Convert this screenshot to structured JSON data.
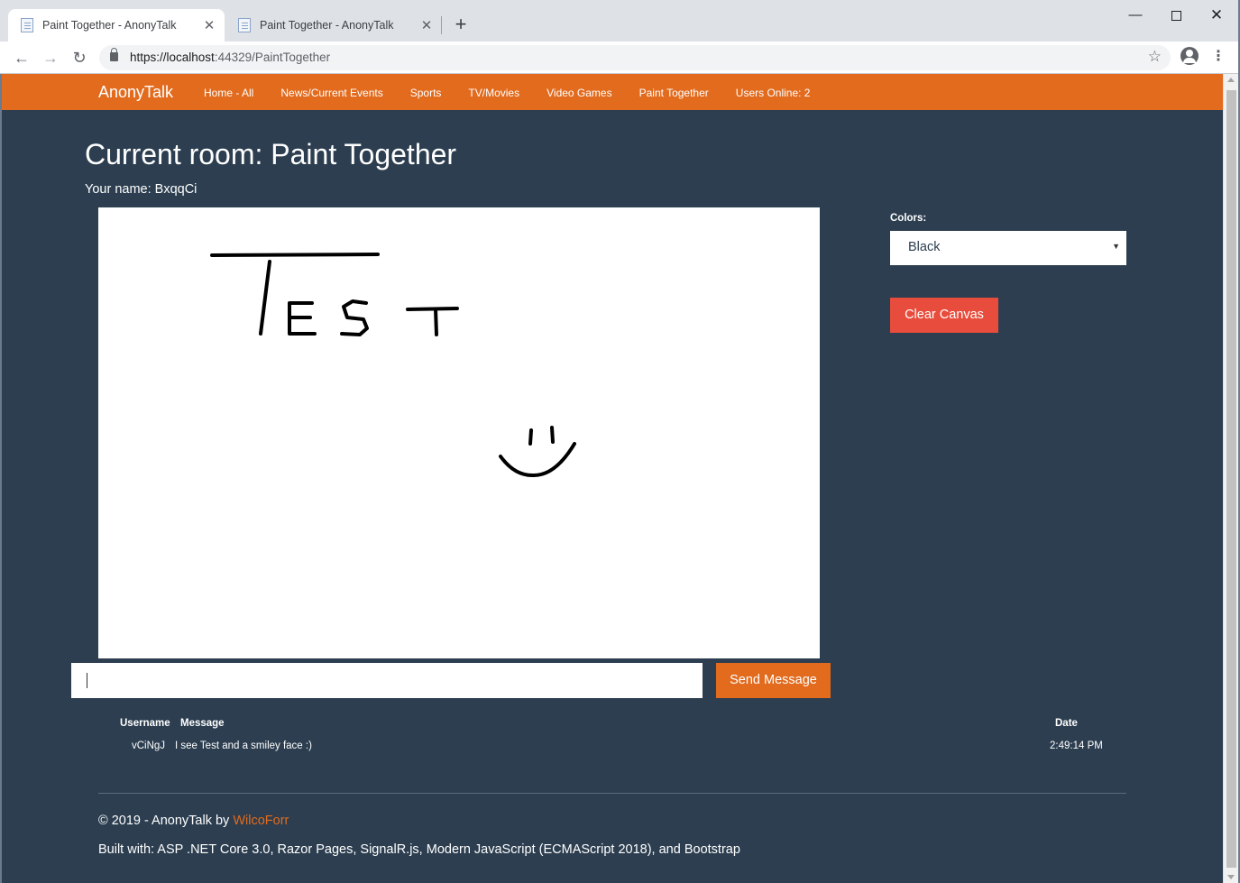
{
  "browser": {
    "tabs": [
      {
        "title": "Paint Together - AnonyTalk",
        "active": true
      },
      {
        "title": "Paint Together - AnonyTalk",
        "active": false
      }
    ],
    "url_prefix": "https://localhost",
    "url_suffix": ":44329/PaintTogether",
    "icons": {
      "back": "arrow-left-icon",
      "forward": "arrow-right-icon",
      "reload": "reload-icon",
      "lock": "lock-icon",
      "bookmark": "star-icon",
      "profile": "account-icon",
      "menu": "kebab-menu-icon"
    }
  },
  "navbar": {
    "brand": "AnonyTalk",
    "links": [
      "Home - All",
      "News/Current Events",
      "Sports",
      "TV/Movies",
      "Video Games",
      "Paint Together",
      "Users Online: 2"
    ],
    "bg_color": "#e26b1e"
  },
  "page": {
    "title": "Current room: Paint Together",
    "your_name": "Your name: BxqqCi",
    "bg_color": "#2c3e50"
  },
  "controls": {
    "colors_label": "Colors:",
    "selected_color": "Black",
    "clear_button": "Clear Canvas",
    "send_button": "Send Message",
    "message_input_value": ""
  },
  "messages": {
    "headers": {
      "username": "Username",
      "message": "Message",
      "date": "Date"
    },
    "rows": [
      {
        "username": "vCiNgJ",
        "message": "I see Test and a smiley face :)",
        "date": "2:49:14 PM"
      }
    ]
  },
  "footer": {
    "copyright": "© 2019 - AnonyTalk by ",
    "author_link": "WilcoForr",
    "built_with": "Built with: ASP .NET Core 3.0, Razor Pages, SignalR.js, Modern JavaScript (ECMAScript 2018), and Bootstrap"
  }
}
